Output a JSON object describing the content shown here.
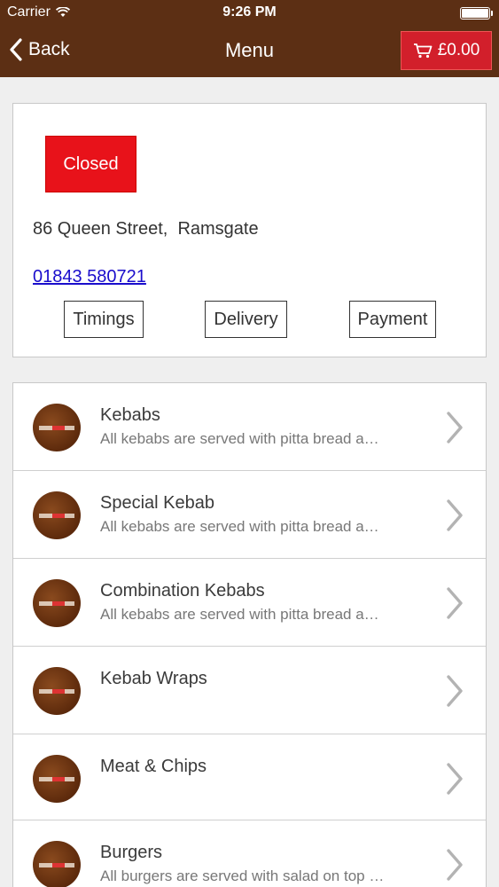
{
  "status_bar": {
    "carrier": "Carrier",
    "time": "9:26 PM"
  },
  "nav": {
    "back_label": "Back",
    "title": "Menu",
    "cart_total": "£0.00"
  },
  "shop": {
    "status": "Closed",
    "address": "86 Queen Street,  Ramsgate",
    "phone": "01843 580721",
    "buttons": {
      "timings": "Timings",
      "delivery": "Delivery",
      "payment": "Payment"
    }
  },
  "menu": [
    {
      "title": "Kebabs",
      "desc": "All kebabs are served with pitta bread a…"
    },
    {
      "title": "Special Kebab",
      "desc": "All kebabs are served with pitta bread a…"
    },
    {
      "title": "Combination Kebabs",
      "desc": "All kebabs are served with pitta bread a…"
    },
    {
      "title": "Kebab Wraps",
      "desc": ""
    },
    {
      "title": "Meat & Chips",
      "desc": ""
    },
    {
      "title": "Burgers",
      "desc": "All burgers are served with salad on top …"
    }
  ],
  "colors": {
    "nav_bg": "#5c2f14",
    "cart_bg": "#d21f2b",
    "closed_bg": "#e8121a",
    "link": "#1a0dcc"
  }
}
